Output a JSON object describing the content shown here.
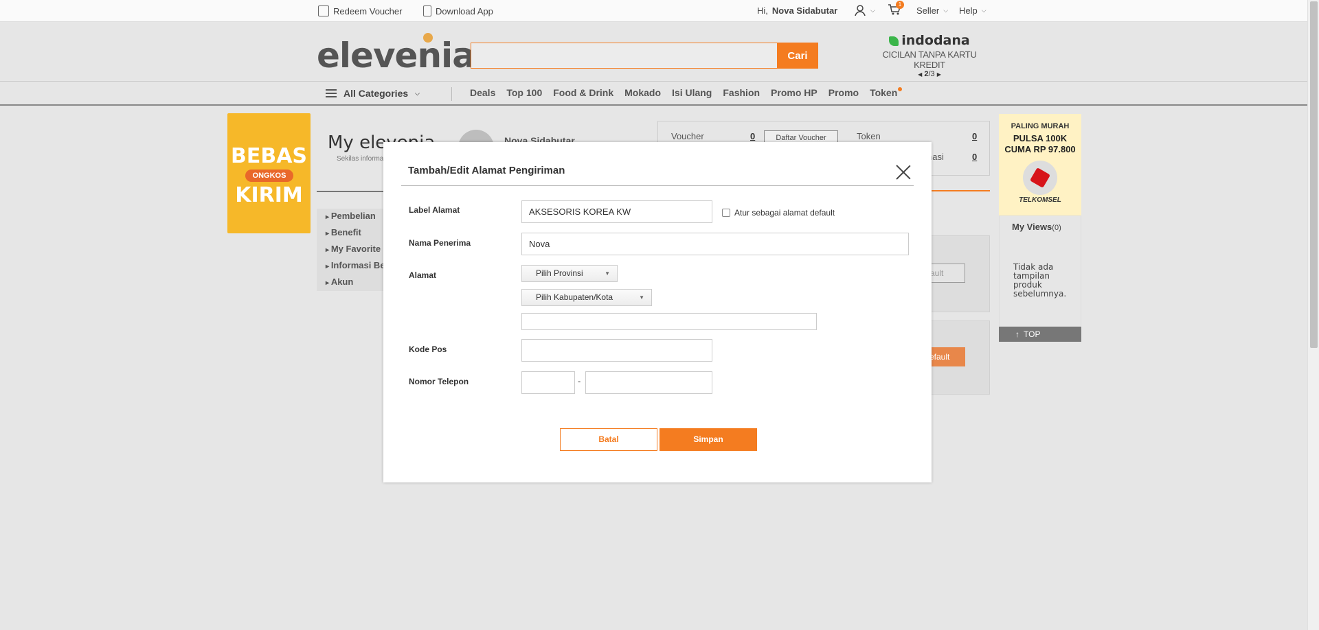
{
  "topbar": {
    "redeem_voucher": "Redeem Voucher",
    "download_app": "Download App",
    "greeting_prefix": "Hi,",
    "user_name": "Nova Sidabutar",
    "cart_count": "1",
    "seller": "Seller",
    "help": "Help"
  },
  "header": {
    "logo_text": "eleveni",
    "logo_tail": "a",
    "search_placeholder": "",
    "search_button": "Cari",
    "ad_brand": "indodana",
    "ad_sub": "CICILAN TANPA KARTU KREDIT",
    "ad_page_current": "2",
    "ad_page_total": "/3"
  },
  "nav": {
    "all_categories": "All Categories",
    "links": [
      "Deals",
      "Top 100",
      "Food & Drink",
      "Mokado",
      "Isi Ulang",
      "Fashion",
      "Promo HP",
      "Promo",
      "Token"
    ]
  },
  "left_promo": {
    "line1": "BEBAS",
    "line2": "ONGKOS",
    "line3": "KIRIM"
  },
  "myelevenia": {
    "title": "My elevenia",
    "subtitle": "Sekilas informasi",
    "user_name": "Nova Sidabutar",
    "menu": [
      "Pembelian",
      "Benefit",
      "My Favorite",
      "Informasi Be",
      "Akun"
    ]
  },
  "voucher_panel": {
    "voucher_label": "Voucher",
    "voucher_count": "0",
    "voucher_button": "Daftar Voucher",
    "token_label": "Token",
    "token_count": "0",
    "second_label": "nasi",
    "second_count": "0",
    "ghost_button": "ault",
    "orange_button": "efault"
  },
  "right_promo": {
    "top": "PALING MURAH",
    "line1": "PULSA 100K",
    "line2": "CUMA RP 97.800",
    "brand": "TELKOMSEL"
  },
  "myviews": {
    "title": "My Views",
    "count": "(0)",
    "empty": "Tidak ada tampilan produk sebelumnya.",
    "top_button": "TOP"
  },
  "modal": {
    "title": "Tambah/Edit Alamat Pengiriman",
    "label_alamat": "Label Alamat",
    "label_alamat_value": "AKSESORIS KOREA KW",
    "default_checkbox": "Atur sebagai alamat default",
    "default_checked": false,
    "nama_penerima": "Nama Penerima",
    "nama_penerima_value": "Nova",
    "alamat": "Alamat",
    "provinsi_select": "Pilih Provinsi",
    "kabupaten_select": "Pilih Kabupaten/Kota",
    "alamat_detail_value": "",
    "kode_pos": "Kode Pos",
    "kode_pos_value": "",
    "nomor_telepon": "Nomor Telepon",
    "phone_separator": "-",
    "phone_prefix_value": "",
    "phone_number_value": "",
    "cancel_button": "Batal",
    "save_button": "Simpan"
  },
  "colors": {
    "accent": "#f47c20",
    "page_bg": "#e6e6e6",
    "promo_yellow": "#f6b829"
  }
}
